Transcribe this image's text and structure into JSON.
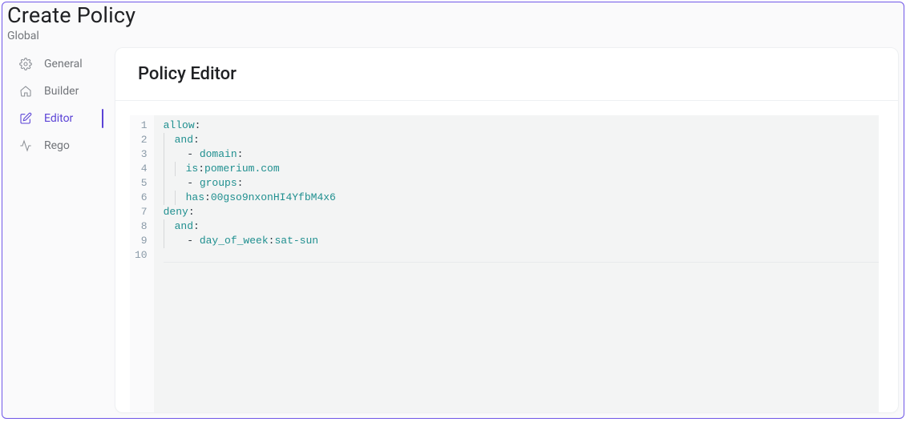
{
  "header": {
    "title": "Create Policy",
    "breadcrumb": "Global"
  },
  "sidebar": {
    "items": [
      {
        "label": "General",
        "icon": "gear-icon",
        "active": false
      },
      {
        "label": "Builder",
        "icon": "home-icon",
        "active": false
      },
      {
        "label": "Editor",
        "icon": "edit-icon",
        "active": true
      },
      {
        "label": "Rego",
        "icon": "activity-icon",
        "active": false
      }
    ]
  },
  "panel": {
    "title": "Policy Editor"
  },
  "code": {
    "lines": [
      {
        "n": 1,
        "indent": 0,
        "key": "allow",
        "colon": true
      },
      {
        "n": 2,
        "indent": 1,
        "guide": true,
        "key": "and",
        "colon": true
      },
      {
        "n": 3,
        "indent": 2,
        "guide": true,
        "dash": true,
        "key": "domain",
        "colon": true
      },
      {
        "n": 4,
        "indent": 3,
        "guide2": true,
        "key": "is",
        "colon": true,
        "value": "pomerium.com"
      },
      {
        "n": 5,
        "indent": 2,
        "guide": true,
        "dash": true,
        "key": "groups",
        "colon": true
      },
      {
        "n": 6,
        "indent": 3,
        "guide2": true,
        "key": "has",
        "colon": true,
        "value": "00gso9nxonHI4YfbM4x6"
      },
      {
        "n": 7,
        "indent": 0,
        "key": "deny",
        "colon": true
      },
      {
        "n": 8,
        "indent": 1,
        "guide": true,
        "key": "and",
        "colon": true
      },
      {
        "n": 9,
        "indent": 2,
        "guide": true,
        "dash": true,
        "key": "day_of_week",
        "colon": true,
        "value": "sat-sun"
      },
      {
        "n": 10,
        "indent": 0
      }
    ]
  }
}
